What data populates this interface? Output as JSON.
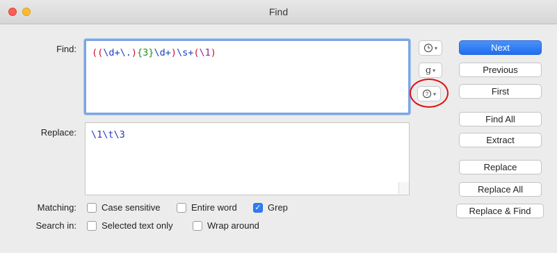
{
  "window": {
    "title": "Find"
  },
  "find": {
    "label": "Find:",
    "tokens": [
      {
        "text": "((",
        "color": "red"
      },
      {
        "text": "\\d+\\.",
        "color": "blue"
      },
      {
        "text": ")",
        "color": "red"
      },
      {
        "text": "{3}",
        "color": "green"
      },
      {
        "text": "\\d+",
        "color": "blue"
      },
      {
        "text": ")",
        "color": "red"
      },
      {
        "text": "\\s+",
        "color": "blue"
      },
      {
        "text": "(",
        "color": "red"
      },
      {
        "text": "\\1",
        "color": "purple"
      },
      {
        "text": ")",
        "color": "red"
      }
    ]
  },
  "replace": {
    "label": "Replace:",
    "value": "\\1\\t\\3"
  },
  "side_icons": {
    "history_icon": "clock-icon",
    "grep_icon_glyph": "g",
    "help_icon": "question-icon"
  },
  "buttons": {
    "next": "Next",
    "previous": "Previous",
    "first": "First",
    "find_all": "Find All",
    "extract": "Extract",
    "replace": "Replace",
    "replace_all": "Replace All",
    "replace_and_find": "Replace & Find"
  },
  "matching": {
    "label": "Matching:",
    "options": [
      {
        "label": "Case sensitive",
        "checked": false
      },
      {
        "label": "Entire word",
        "checked": false
      },
      {
        "label": "Grep",
        "checked": true
      }
    ]
  },
  "search_in": {
    "label": "Search in:",
    "options": [
      {
        "label": "Selected text only",
        "checked": false
      },
      {
        "label": "Wrap around",
        "checked": false
      }
    ]
  },
  "colors": {
    "red": "#c8102e",
    "blue": "#1c3fc0",
    "green": "#2b8a20",
    "purple": "#8a1db0",
    "accent": "#2f7cf6",
    "highlight_ring": "#e01010"
  }
}
